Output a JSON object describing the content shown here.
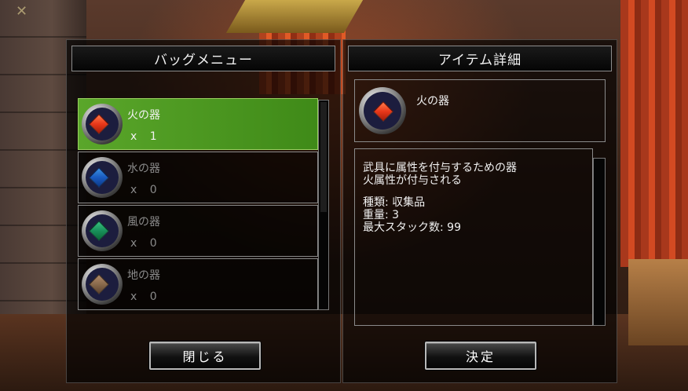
{
  "bag_menu": {
    "title": "バッグメニュー",
    "items": [
      {
        "name": "火の器",
        "qty": "x 1",
        "gem_color": "#e8381a",
        "icon": "fire-gem-icon"
      },
      {
        "name": "水の器",
        "qty": "x 0",
        "gem_color": "#1a5ac0",
        "icon": "water-gem-icon"
      },
      {
        "name": "風の器",
        "qty": "x 0",
        "gem_color": "#18905a",
        "icon": "wind-gem-icon"
      },
      {
        "name": "地の器",
        "qty": "x 0",
        "gem_color": "#8a6a4c",
        "icon": "earth-gem-icon"
      }
    ],
    "selected_index": 0,
    "close_label": "閉じる"
  },
  "item_detail": {
    "title": "アイテム詳細",
    "name": "火の器",
    "icon": "fire-gem-icon",
    "description": [
      "武具に属性を付与するための器",
      "火属性が付与される"
    ],
    "stats": [
      "種類: 収集品",
      "重量: 3",
      "最大スタック数: 99"
    ],
    "ok_label": "決定"
  },
  "colors": {
    "selected_row": "#4c9a20",
    "panel_border": "#8a8a8a"
  }
}
